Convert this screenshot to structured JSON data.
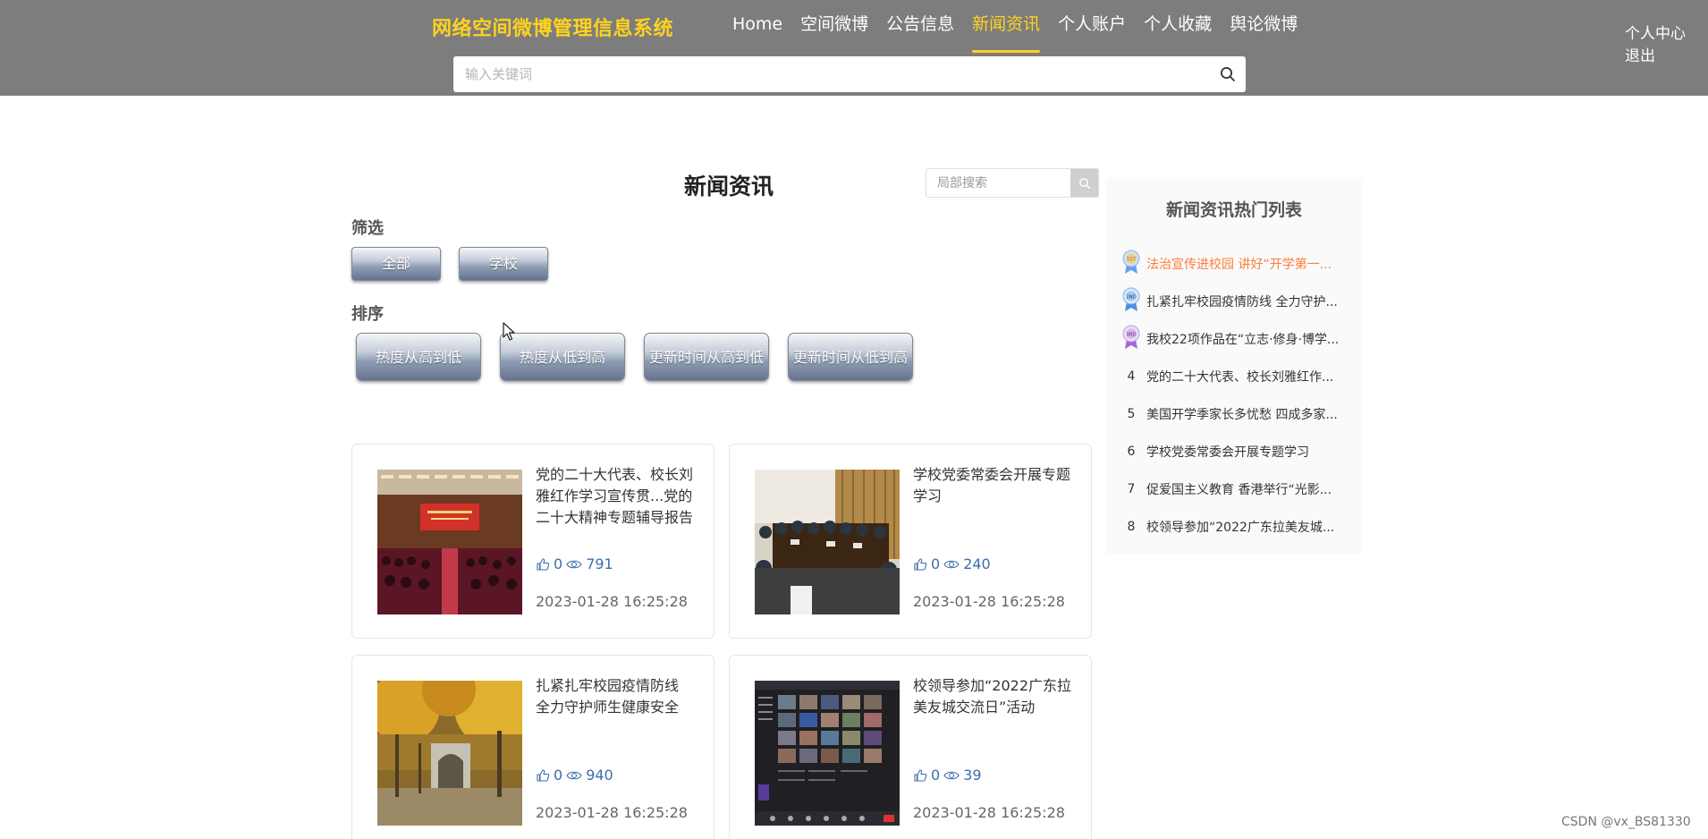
{
  "header": {
    "brand": "网络空间微博管理信息系统",
    "nav": [
      {
        "label": "Home"
      },
      {
        "label": "空间微博"
      },
      {
        "label": "公告信息"
      },
      {
        "label": "新闻资讯",
        "active": true
      },
      {
        "label": "个人账户"
      },
      {
        "label": "个人收藏"
      },
      {
        "label": "舆论微博"
      }
    ],
    "user_center": "个人中心",
    "logout": "退出",
    "search_placeholder": "输入关键词",
    "accent_color": "#ffd21e"
  },
  "main": {
    "title": "新闻资讯",
    "local_search_placeholder": "局部搜索",
    "filter_label": "筛选",
    "filters": [
      "全部",
      "学校"
    ],
    "sort_label": "排序",
    "sorts": [
      "热度从高到低",
      "热度从低到高",
      "更新时间从高到低",
      "更新时间从低到高"
    ],
    "cards": [
      {
        "title": "党的二十大代表、校长刘雅红作学习宣传贯...党的二十大精神专题辅导报告",
        "likes": "0",
        "views": "791",
        "date": "2023-01-28 16:25:28"
      },
      {
        "title": "学校党委常委会开展专题学习",
        "likes": "0",
        "views": "240",
        "date": "2023-01-28 16:25:28"
      },
      {
        "title": "扎紧扎牢校园疫情防线 全力守护师生健康安全",
        "likes": "0",
        "views": "940",
        "date": "2023-01-28 16:25:28"
      },
      {
        "title": "校领导参加“2022广东拉美友城交流日”活动",
        "likes": "0",
        "views": "39",
        "date": "2023-01-28 16:25:28"
      }
    ]
  },
  "sidebar": {
    "title": "新闻资讯热门列表",
    "items": [
      {
        "rank": "1",
        "text": "法治宣传进校园 讲好“开学第一..."
      },
      {
        "rank": "2",
        "text": "扎紧扎牢校园疫情防线 全力守护..."
      },
      {
        "rank": "3",
        "text": "我校22项作品在“立志·修身·博学..."
      },
      {
        "rank": "4",
        "text": "党的二十大代表、校长刘雅红作..."
      },
      {
        "rank": "5",
        "text": "美国开学季家长多忧愁 四成多家..."
      },
      {
        "rank": "6",
        "text": "学校党委常委会开展专题学习"
      },
      {
        "rank": "7",
        "text": "促爱国主义教育 香港举行“光影..."
      },
      {
        "rank": "8",
        "text": "校领导参加“2022广东拉美友城..."
      }
    ]
  },
  "watermark": "CSDN @vx_BS81330"
}
